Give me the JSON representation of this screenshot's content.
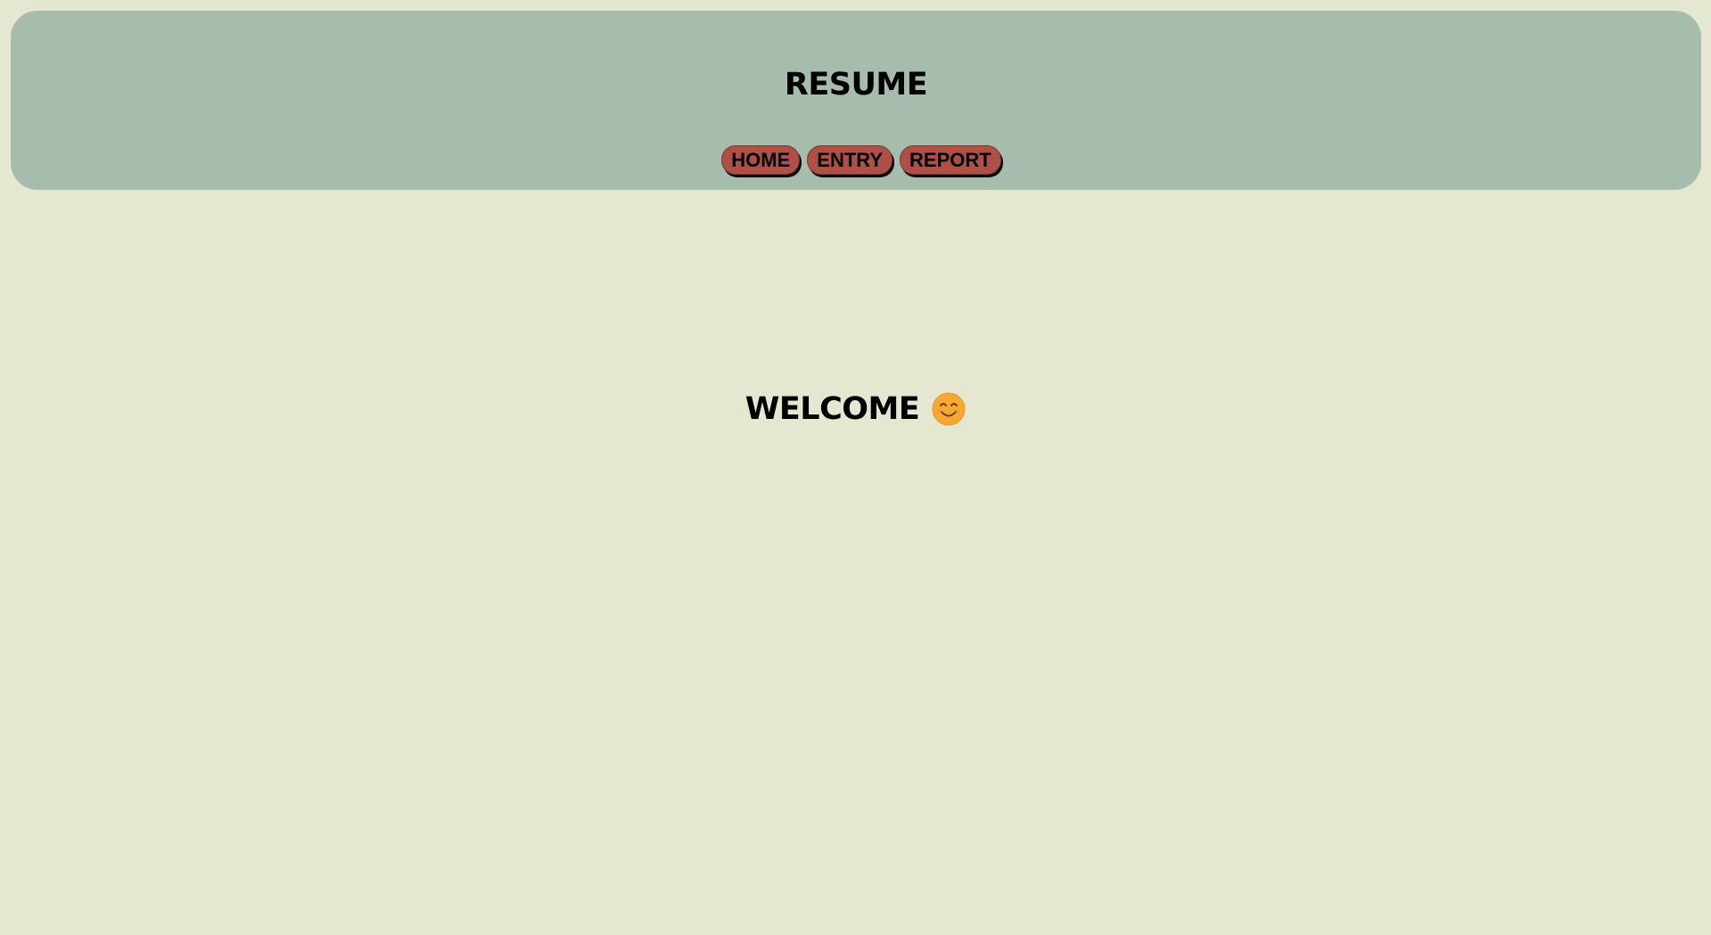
{
  "header": {
    "title": "RESUME",
    "nav": [
      {
        "label": "HOME"
      },
      {
        "label": "ENTRY"
      },
      {
        "label": "REPORT"
      }
    ]
  },
  "main": {
    "welcome_text": "WELCOME",
    "welcome_icon": "smiling-face-icon"
  },
  "colors": {
    "page_background": "#e5e7d1",
    "header_background": "#a6bdae",
    "nav_button": "#b04f45",
    "emoji_face": "#f6a833"
  }
}
